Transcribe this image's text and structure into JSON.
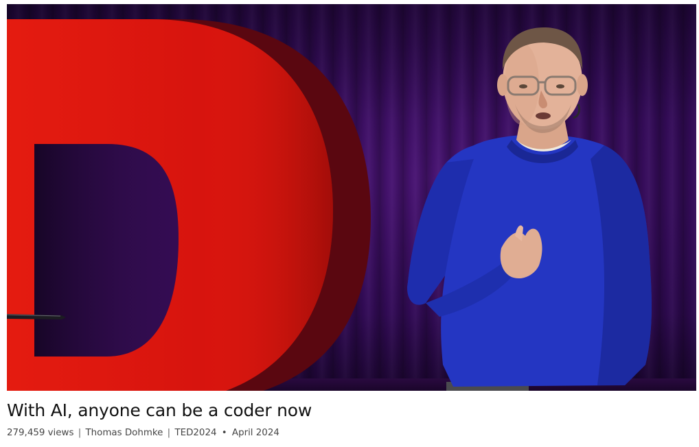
{
  "talk": {
    "title": "With AI, anyone can be a coder now",
    "views": "279,459 views",
    "speaker": "Thomas Dohmke",
    "event": "TED2024",
    "date": "April 2024",
    "separator": "|",
    "bullet": "•"
  },
  "colors": {
    "curtain": "#330b58",
    "ted_red": "#e1160f",
    "sweater": "#2233b8"
  },
  "icons": [
    "ted-letter-d",
    "microphone-stand"
  ]
}
